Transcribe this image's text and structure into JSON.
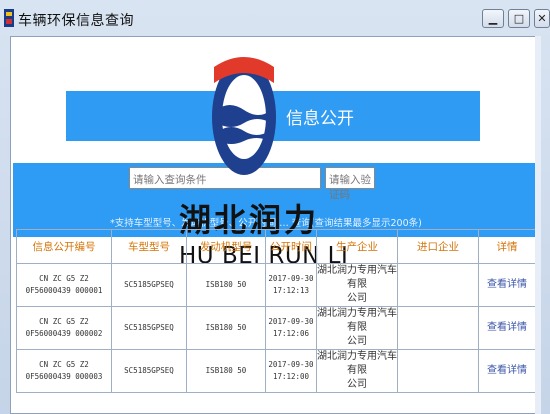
{
  "window": {
    "title": "车辆环保信息查询"
  },
  "banner": {
    "title": "信息公开"
  },
  "search": {
    "query_placeholder": "请输入查询条件",
    "captcha_placeholder": "请输入验证码",
    "notice": "*支持车型型号、发动机型号、公开时间 … 查询(查询结果最多显示200条)"
  },
  "logo": {
    "cn": "湖北润力",
    "en": "HU BEI RUN LI"
  },
  "table": {
    "headers": [
      "信息公开编号",
      "车型型号",
      "发动机型号",
      "公开时间",
      "生产企业",
      "进口企业",
      "详情"
    ],
    "rows": [
      {
        "id": [
          "CN ZC G5 Z2",
          "0F56000439 000001"
        ],
        "model": "SC5185GPSEQ",
        "engine": "ISB180 50",
        "time": [
          "2017-09-30",
          "17:12:13"
        ],
        "maker": [
          "湖北润力专用汽车有限",
          "公司"
        ],
        "importer": "",
        "detail": "查看详情"
      },
      {
        "id": [
          "CN ZC G5 Z2",
          "0F56000439 000002"
        ],
        "model": "SC5185GPSEQ",
        "engine": "ISB180 50",
        "time": [
          "2017-09-30",
          "17:12:06"
        ],
        "maker": [
          "湖北润力专用汽车有限",
          "公司"
        ],
        "importer": "",
        "detail": "查看详情"
      },
      {
        "id": [
          "CN ZC G5 Z2",
          "0F56000439 000003"
        ],
        "model": "SC5185GPSEQ",
        "engine": "ISB180 50",
        "time": [
          "2017-09-30",
          "17:12:00"
        ],
        "maker": [
          "湖北润力专用汽车有限",
          "公司"
        ],
        "importer": "",
        "detail": "查看详情"
      }
    ]
  },
  "colors": {
    "banner": "#2f9bf2",
    "header_text": "#d4760a",
    "link": "#3a55a8"
  }
}
